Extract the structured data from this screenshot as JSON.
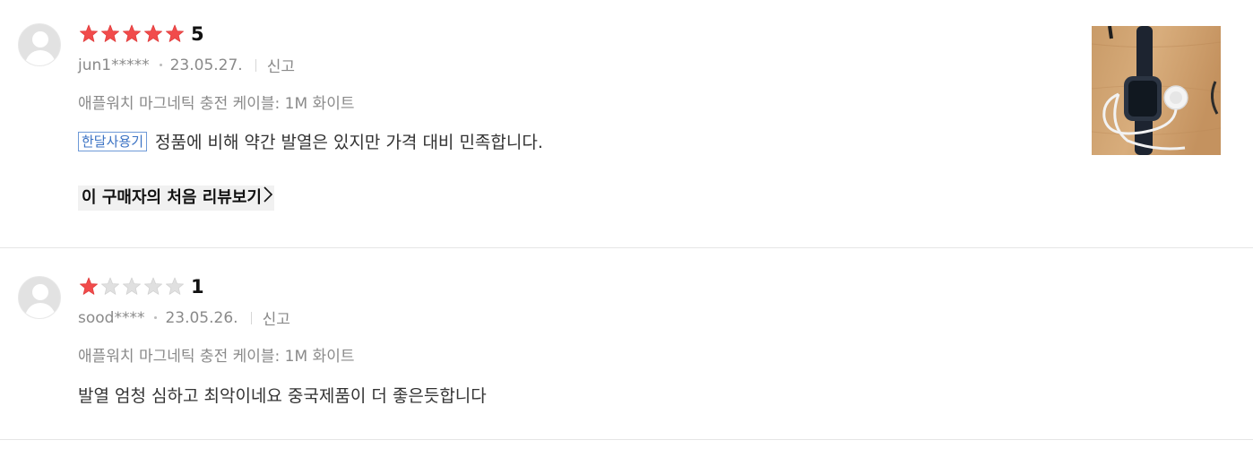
{
  "reviews": [
    {
      "rating": "5",
      "stars_filled": 5,
      "stars_total": 5,
      "user": "jun1*****",
      "date": "23.05.27.",
      "report_label": "신고",
      "option": "애플워치 마그네틱 충전 케이블: 1M 화이트",
      "badge": "한달사용기",
      "content": "정품에 비해 약간 발열은 있지만 가격 대비 민족합니다.",
      "first_review_link": "이 구매자의 처음 리뷰보기",
      "has_photo": true
    },
    {
      "rating": "1",
      "stars_filled": 1,
      "stars_total": 5,
      "user": "sood****",
      "date": "23.05.26.",
      "report_label": "신고",
      "option": "애플워치 마그네틱 충전 케이블: 1M 화이트",
      "content": "발열 엄청 심하고 최악이네요 중국제품이 더 좋은듯합니다",
      "has_photo": false
    }
  ],
  "colors": {
    "star_filled": "#f14b4b",
    "star_empty": "#e0e0e0",
    "badge": "#3c73c4",
    "meta_text": "#8a8a8a",
    "divider": "#e5e5e5"
  },
  "icons": {
    "avatar": "default-profile-icon",
    "star": "star-icon",
    "chevron": "chevron-right-icon"
  }
}
